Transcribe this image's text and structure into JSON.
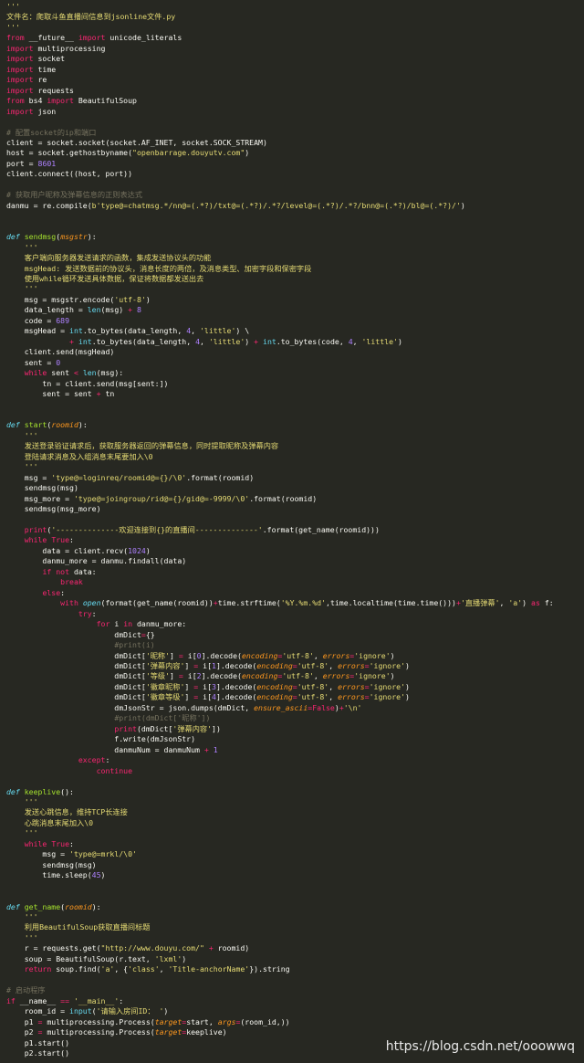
{
  "watermark": "https://blog.csdn.net/ooowwq",
  "code_lines": [
    [
      [
        "str",
        "'''"
      ]
    ],
    [
      [
        "str",
        "文件名：爬取斗鱼直播间信息到jsonline文件.py"
      ]
    ],
    [
      [
        "str",
        "'''"
      ]
    ],
    [
      [
        "kw",
        "from"
      ],
      [
        "plain",
        " __future__ "
      ],
      [
        "kw",
        "import"
      ],
      [
        "plain",
        " unicode_literals"
      ]
    ],
    [
      [
        "kw",
        "import"
      ],
      [
        "plain",
        " multiprocessing"
      ]
    ],
    [
      [
        "kw",
        "import"
      ],
      [
        "plain",
        " socket"
      ]
    ],
    [
      [
        "kw",
        "import"
      ],
      [
        "plain",
        " time"
      ]
    ],
    [
      [
        "kw",
        "import"
      ],
      [
        "plain",
        " re"
      ]
    ],
    [
      [
        "kw",
        "import"
      ],
      [
        "plain",
        " requests"
      ]
    ],
    [
      [
        "kw",
        "from"
      ],
      [
        "plain",
        " bs4 "
      ],
      [
        "kw",
        "import"
      ],
      [
        "plain",
        " BeautifulSoup"
      ]
    ],
    [
      [
        "kw",
        "import"
      ],
      [
        "plain",
        " json"
      ]
    ],
    [],
    [
      [
        "cmt",
        "# 配置socket的ip和端口"
      ]
    ],
    [
      [
        "plain",
        "client = socket.socket(socket.AF_INET, socket.SOCK_STREAM)"
      ]
    ],
    [
      [
        "plain",
        "host = socket.gethostbyname("
      ],
      [
        "str",
        "\"openbarrage.douyutv.com\""
      ],
      [
        "plain",
        ")"
      ]
    ],
    [
      [
        "plain",
        "port = "
      ],
      [
        "num",
        "8601"
      ]
    ],
    [
      [
        "plain",
        "client.connect((host, port))"
      ]
    ],
    [],
    [
      [
        "cmt",
        "# 获取用户昵称及弹幕信息的正则表达式"
      ]
    ],
    [
      [
        "plain",
        "danmu = re.compile("
      ],
      [
        "str",
        "b'type@=chatmsg.*/nn@=(.*?)/txt@=(.*?)/.*?/level@=(.*?)/.*?/bnn@=(.*?)/bl@=(.*?)/'"
      ],
      [
        "plain",
        ")"
      ]
    ],
    [],
    [],
    [
      [
        "def",
        "def"
      ],
      [
        "plain",
        " "
      ],
      [
        "fn",
        "sendmsg"
      ],
      [
        "plain",
        "("
      ],
      [
        "param",
        "msgstr"
      ],
      [
        "plain",
        "):"
      ]
    ],
    [
      [
        "plain",
        "    "
      ],
      [
        "str",
        "'''"
      ]
    ],
    [
      [
        "plain",
        "    "
      ],
      [
        "str",
        "客户端向服务器发送请求的函数，集成发送协议头的功能"
      ]
    ],
    [
      [
        "plain",
        "    "
      ],
      [
        "str",
        "msgHead: 发送数据前的协议头，消息长度的两倍，及消息类型、加密字段和保密字段"
      ]
    ],
    [
      [
        "plain",
        "    "
      ],
      [
        "str",
        "使用while循环发送具体数据，保证将数据都发送出去"
      ]
    ],
    [
      [
        "plain",
        "    "
      ],
      [
        "str",
        "'''"
      ]
    ],
    [
      [
        "plain",
        "    msg = msgstr.encode("
      ],
      [
        "str",
        "'utf-8'"
      ],
      [
        "plain",
        ")"
      ]
    ],
    [
      [
        "plain",
        "    data_length = "
      ],
      [
        "builtin",
        "len"
      ],
      [
        "plain",
        "(msg) "
      ],
      [
        "op",
        "+"
      ],
      [
        "plain",
        " "
      ],
      [
        "num",
        "8"
      ]
    ],
    [
      [
        "plain",
        "    code = "
      ],
      [
        "num",
        "689"
      ]
    ],
    [
      [
        "plain",
        "    msgHead = "
      ],
      [
        "builtin",
        "int"
      ],
      [
        "plain",
        ".to_bytes(data_length, "
      ],
      [
        "num",
        "4"
      ],
      [
        "plain",
        ", "
      ],
      [
        "str",
        "'little'"
      ],
      [
        "plain",
        ") \\"
      ]
    ],
    [
      [
        "plain",
        "              "
      ],
      [
        "op",
        "+"
      ],
      [
        "plain",
        " "
      ],
      [
        "builtin",
        "int"
      ],
      [
        "plain",
        ".to_bytes(data_length, "
      ],
      [
        "num",
        "4"
      ],
      [
        "plain",
        ", "
      ],
      [
        "str",
        "'little'"
      ],
      [
        "plain",
        ") "
      ],
      [
        "op",
        "+"
      ],
      [
        "plain",
        " "
      ],
      [
        "builtin",
        "int"
      ],
      [
        "plain",
        ".to_bytes(code, "
      ],
      [
        "num",
        "4"
      ],
      [
        "plain",
        ", "
      ],
      [
        "str",
        "'little'"
      ],
      [
        "plain",
        ")"
      ]
    ],
    [
      [
        "plain",
        "    client.send(msgHead)"
      ]
    ],
    [
      [
        "plain",
        "    sent = "
      ],
      [
        "num",
        "0"
      ]
    ],
    [
      [
        "plain",
        "    "
      ],
      [
        "kw",
        "while"
      ],
      [
        "plain",
        " sent "
      ],
      [
        "op",
        "<"
      ],
      [
        "plain",
        " "
      ],
      [
        "builtin",
        "len"
      ],
      [
        "plain",
        "(msg):"
      ]
    ],
    [
      [
        "plain",
        "        tn = client.send(msg[sent:])"
      ]
    ],
    [
      [
        "plain",
        "        sent = sent "
      ],
      [
        "op",
        "+"
      ],
      [
        "plain",
        " tn"
      ]
    ],
    [],
    [],
    [
      [
        "def",
        "def"
      ],
      [
        "plain",
        " "
      ],
      [
        "fn",
        "start"
      ],
      [
        "plain",
        "("
      ],
      [
        "param",
        "roomid"
      ],
      [
        "plain",
        "):"
      ]
    ],
    [
      [
        "plain",
        "    "
      ],
      [
        "str",
        "'''"
      ]
    ],
    [
      [
        "plain",
        "    "
      ],
      [
        "str",
        "发送登录验证请求后，获取服务器返回的弹幕信息，同时提取昵称及弹幕内容"
      ]
    ],
    [
      [
        "plain",
        "    "
      ],
      [
        "str",
        "登陆请求消息及入组消息末尾要加入\\0"
      ]
    ],
    [
      [
        "plain",
        "    "
      ],
      [
        "str",
        "'''"
      ]
    ],
    [
      [
        "plain",
        "    msg = "
      ],
      [
        "str",
        "'type@=loginreq/roomid@={}/\\0'"
      ],
      [
        "plain",
        ".format(roomid)"
      ]
    ],
    [
      [
        "plain",
        "    sendmsg(msg)"
      ]
    ],
    [
      [
        "plain",
        "    msg_more = "
      ],
      [
        "str",
        "'type@=joingroup/rid@={}/gid@=-9999/\\0'"
      ],
      [
        "plain",
        ".format(roomid)"
      ]
    ],
    [
      [
        "plain",
        "    sendmsg(msg_more)"
      ]
    ],
    [],
    [
      [
        "plain",
        "    "
      ],
      [
        "kw",
        "print"
      ],
      [
        "plain",
        "("
      ],
      [
        "str",
        "'--------------欢迎连接到{}的直播间--------------'"
      ],
      [
        "plain",
        ".format(get_name(roomid)))"
      ]
    ],
    [
      [
        "plain",
        "    "
      ],
      [
        "kw",
        "while"
      ],
      [
        "plain",
        " "
      ],
      [
        "kw",
        "True"
      ],
      [
        "plain",
        ":"
      ]
    ],
    [
      [
        "plain",
        "        data = client.recv("
      ],
      [
        "num",
        "1024"
      ],
      [
        "plain",
        ")"
      ]
    ],
    [
      [
        "plain",
        "        danmu_more = danmu.findall(data)"
      ]
    ],
    [
      [
        "plain",
        "        "
      ],
      [
        "kw",
        "if"
      ],
      [
        "plain",
        " "
      ],
      [
        "kw",
        "not"
      ],
      [
        "plain",
        " data:"
      ]
    ],
    [
      [
        "plain",
        "            "
      ],
      [
        "kw",
        "break"
      ]
    ],
    [
      [
        "plain",
        "        "
      ],
      [
        "kw",
        "else"
      ],
      [
        "plain",
        ":"
      ]
    ],
    [
      [
        "plain",
        "            "
      ],
      [
        "kw",
        "with"
      ],
      [
        "plain",
        " "
      ],
      [
        "def",
        "open"
      ],
      [
        "plain",
        "(format(get_name(roomid))"
      ],
      [
        "op",
        "+"
      ],
      [
        "plain",
        "time.strftime("
      ],
      [
        "str",
        "'%Y.%m.%d'"
      ],
      [
        "plain",
        ",time.localtime(time.time()))"
      ],
      [
        "op",
        "+"
      ],
      [
        "str",
        "'直播弹幕'"
      ],
      [
        "plain",
        ", "
      ],
      [
        "str",
        "'a'"
      ],
      [
        "plain",
        ") "
      ],
      [
        "kw",
        "as"
      ],
      [
        "plain",
        " f:"
      ]
    ],
    [
      [
        "plain",
        "                "
      ],
      [
        "kw",
        "try"
      ],
      [
        "plain",
        ":"
      ]
    ],
    [
      [
        "plain",
        "                    "
      ],
      [
        "kw",
        "for"
      ],
      [
        "plain",
        " i "
      ],
      [
        "kw",
        "in"
      ],
      [
        "plain",
        " danmu_more:"
      ]
    ],
    [
      [
        "plain",
        "                        dmDict"
      ],
      [
        "op",
        "="
      ],
      [
        "plain",
        "{}"
      ]
    ],
    [
      [
        "plain",
        "                        "
      ],
      [
        "cmt",
        "#print(i)"
      ]
    ],
    [
      [
        "plain",
        "                        dmDict["
      ],
      [
        "str",
        "'昵称'"
      ],
      [
        "plain",
        "] "
      ],
      [
        "op",
        "="
      ],
      [
        "plain",
        " i["
      ],
      [
        "num",
        "0"
      ],
      [
        "plain",
        "].decode("
      ],
      [
        "kwarg",
        "encoding"
      ],
      [
        "op",
        "="
      ],
      [
        "str",
        "'utf-8'"
      ],
      [
        "plain",
        ", "
      ],
      [
        "kwarg",
        "errors"
      ],
      [
        "op",
        "="
      ],
      [
        "str",
        "'ignore'"
      ],
      [
        "plain",
        ")"
      ]
    ],
    [
      [
        "plain",
        "                        dmDict["
      ],
      [
        "str",
        "'弹幕内容'"
      ],
      [
        "plain",
        "] "
      ],
      [
        "op",
        "="
      ],
      [
        "plain",
        " i["
      ],
      [
        "num",
        "1"
      ],
      [
        "plain",
        "].decode("
      ],
      [
        "kwarg",
        "encoding"
      ],
      [
        "op",
        "="
      ],
      [
        "str",
        "'utf-8'"
      ],
      [
        "plain",
        ", "
      ],
      [
        "kwarg",
        "errors"
      ],
      [
        "op",
        "="
      ],
      [
        "str",
        "'ignore'"
      ],
      [
        "plain",
        ")"
      ]
    ],
    [
      [
        "plain",
        "                        dmDict["
      ],
      [
        "str",
        "'等级'"
      ],
      [
        "plain",
        "] "
      ],
      [
        "op",
        "="
      ],
      [
        "plain",
        " i["
      ],
      [
        "num",
        "2"
      ],
      [
        "plain",
        "].decode("
      ],
      [
        "kwarg",
        "encoding"
      ],
      [
        "op",
        "="
      ],
      [
        "str",
        "'utf-8'"
      ],
      [
        "plain",
        ", "
      ],
      [
        "kwarg",
        "errors"
      ],
      [
        "op",
        "="
      ],
      [
        "str",
        "'ignore'"
      ],
      [
        "plain",
        ")"
      ]
    ],
    [
      [
        "plain",
        "                        dmDict["
      ],
      [
        "str",
        "'徽章昵称'"
      ],
      [
        "plain",
        "] "
      ],
      [
        "op",
        "="
      ],
      [
        "plain",
        " i["
      ],
      [
        "num",
        "3"
      ],
      [
        "plain",
        "].decode("
      ],
      [
        "kwarg",
        "encoding"
      ],
      [
        "op",
        "="
      ],
      [
        "str",
        "'utf-8'"
      ],
      [
        "plain",
        ", "
      ],
      [
        "kwarg",
        "errors"
      ],
      [
        "op",
        "="
      ],
      [
        "str",
        "'ignore'"
      ],
      [
        "plain",
        ")"
      ]
    ],
    [
      [
        "plain",
        "                        dmDict["
      ],
      [
        "str",
        "'徽章等级'"
      ],
      [
        "plain",
        "] "
      ],
      [
        "op",
        "="
      ],
      [
        "plain",
        " i["
      ],
      [
        "num",
        "4"
      ],
      [
        "plain",
        "].decode("
      ],
      [
        "kwarg",
        "encoding"
      ],
      [
        "op",
        "="
      ],
      [
        "str",
        "'utf-8'"
      ],
      [
        "plain",
        ", "
      ],
      [
        "kwarg",
        "errors"
      ],
      [
        "op",
        "="
      ],
      [
        "str",
        "'ignore'"
      ],
      [
        "plain",
        ")"
      ]
    ],
    [
      [
        "plain",
        "                        dmJsonStr = json.dumps(dmDict, "
      ],
      [
        "kwarg",
        "ensure_ascii"
      ],
      [
        "op",
        "="
      ],
      [
        "kw",
        "False"
      ],
      [
        "plain",
        ")"
      ],
      [
        "op",
        "+"
      ],
      [
        "str",
        "'\\n'"
      ]
    ],
    [
      [
        "plain",
        "                        "
      ],
      [
        "cmt",
        "#print(dmDict['昵称'])"
      ]
    ],
    [
      [
        "plain",
        "                        "
      ],
      [
        "kw",
        "print"
      ],
      [
        "plain",
        "(dmDict["
      ],
      [
        "str",
        "'弹幕内容'"
      ],
      [
        "plain",
        "])"
      ]
    ],
    [
      [
        "plain",
        "                        f.write(dmJsonStr)"
      ]
    ],
    [
      [
        "plain",
        "                        danmuNum = danmuNum "
      ],
      [
        "op",
        "+"
      ],
      [
        "plain",
        " "
      ],
      [
        "num",
        "1"
      ]
    ],
    [
      [
        "plain",
        "                "
      ],
      [
        "kw",
        "except"
      ],
      [
        "plain",
        ":"
      ]
    ],
    [
      [
        "plain",
        "                    "
      ],
      [
        "kw",
        "continue"
      ]
    ],
    [],
    [
      [
        "def",
        "def"
      ],
      [
        "plain",
        " "
      ],
      [
        "fn",
        "keeplive"
      ],
      [
        "plain",
        "():"
      ]
    ],
    [
      [
        "plain",
        "    "
      ],
      [
        "str",
        "'''"
      ]
    ],
    [
      [
        "plain",
        "    "
      ],
      [
        "str",
        "发送心跳信息，维持TCP长连接"
      ]
    ],
    [
      [
        "plain",
        "    "
      ],
      [
        "str",
        "心跳消息末尾加入\\0"
      ]
    ],
    [
      [
        "plain",
        "    "
      ],
      [
        "str",
        "'''"
      ]
    ],
    [
      [
        "plain",
        "    "
      ],
      [
        "kw",
        "while"
      ],
      [
        "plain",
        " "
      ],
      [
        "kw",
        "True"
      ],
      [
        "plain",
        ":"
      ]
    ],
    [
      [
        "plain",
        "        msg = "
      ],
      [
        "str",
        "'type@=mrkl/\\0'"
      ]
    ],
    [
      [
        "plain",
        "        sendmsg(msg)"
      ]
    ],
    [
      [
        "plain",
        "        time.sleep("
      ],
      [
        "num",
        "45"
      ],
      [
        "plain",
        ")"
      ]
    ],
    [],
    [],
    [
      [
        "def",
        "def"
      ],
      [
        "plain",
        " "
      ],
      [
        "fn",
        "get_name"
      ],
      [
        "plain",
        "("
      ],
      [
        "param",
        "roomid"
      ],
      [
        "plain",
        "):"
      ]
    ],
    [
      [
        "plain",
        "    "
      ],
      [
        "str",
        "'''"
      ]
    ],
    [
      [
        "plain",
        "    "
      ],
      [
        "str",
        "利用BeautifulSoup获取直播间标题"
      ]
    ],
    [
      [
        "plain",
        "    "
      ],
      [
        "str",
        "'''"
      ]
    ],
    [
      [
        "plain",
        "    r = requests.get("
      ],
      [
        "str",
        "\"http://www.douyu.com/\""
      ],
      [
        "plain",
        " "
      ],
      [
        "op",
        "+"
      ],
      [
        "plain",
        " roomid)"
      ]
    ],
    [
      [
        "plain",
        "    soup = BeautifulSoup(r.text, "
      ],
      [
        "str",
        "'lxml'"
      ],
      [
        "plain",
        ")"
      ]
    ],
    [
      [
        "plain",
        "    "
      ],
      [
        "kw",
        "return"
      ],
      [
        "plain",
        " soup.find("
      ],
      [
        "str",
        "'a'"
      ],
      [
        "plain",
        ", {"
      ],
      [
        "str",
        "'class'"
      ],
      [
        "plain",
        ", "
      ],
      [
        "str",
        "'Title-anchorName'"
      ],
      [
        "plain",
        "}).string"
      ]
    ],
    [],
    [
      [
        "cmt",
        "# 启动程序"
      ]
    ],
    [
      [
        "kw",
        "if"
      ],
      [
        "plain",
        " __name__ "
      ],
      [
        "op",
        "=="
      ],
      [
        "plain",
        " "
      ],
      [
        "str",
        "'__main__'"
      ],
      [
        "plain",
        ":"
      ]
    ],
    [
      [
        "plain",
        "    room_id = "
      ],
      [
        "builtin",
        "input"
      ],
      [
        "plain",
        "("
      ],
      [
        "str",
        "'请输入房间ID： '"
      ],
      [
        "plain",
        ")"
      ]
    ],
    [
      [
        "plain",
        "    p1 "
      ],
      [
        "op",
        "="
      ],
      [
        "plain",
        " multiprocessing.Process("
      ],
      [
        "kwarg",
        "target"
      ],
      [
        "op",
        "="
      ],
      [
        "plain",
        "start, "
      ],
      [
        "kwarg",
        "args"
      ],
      [
        "op",
        "="
      ],
      [
        "plain",
        "(room_id,))"
      ]
    ],
    [
      [
        "plain",
        "    p2 "
      ],
      [
        "op",
        "="
      ],
      [
        "plain",
        " multiprocessing.Process("
      ],
      [
        "kwarg",
        "target"
      ],
      [
        "op",
        "="
      ],
      [
        "plain",
        "keeplive)"
      ]
    ],
    [
      [
        "plain",
        "    p1.start()"
      ]
    ],
    [
      [
        "plain",
        "    p2.start()"
      ]
    ]
  ]
}
